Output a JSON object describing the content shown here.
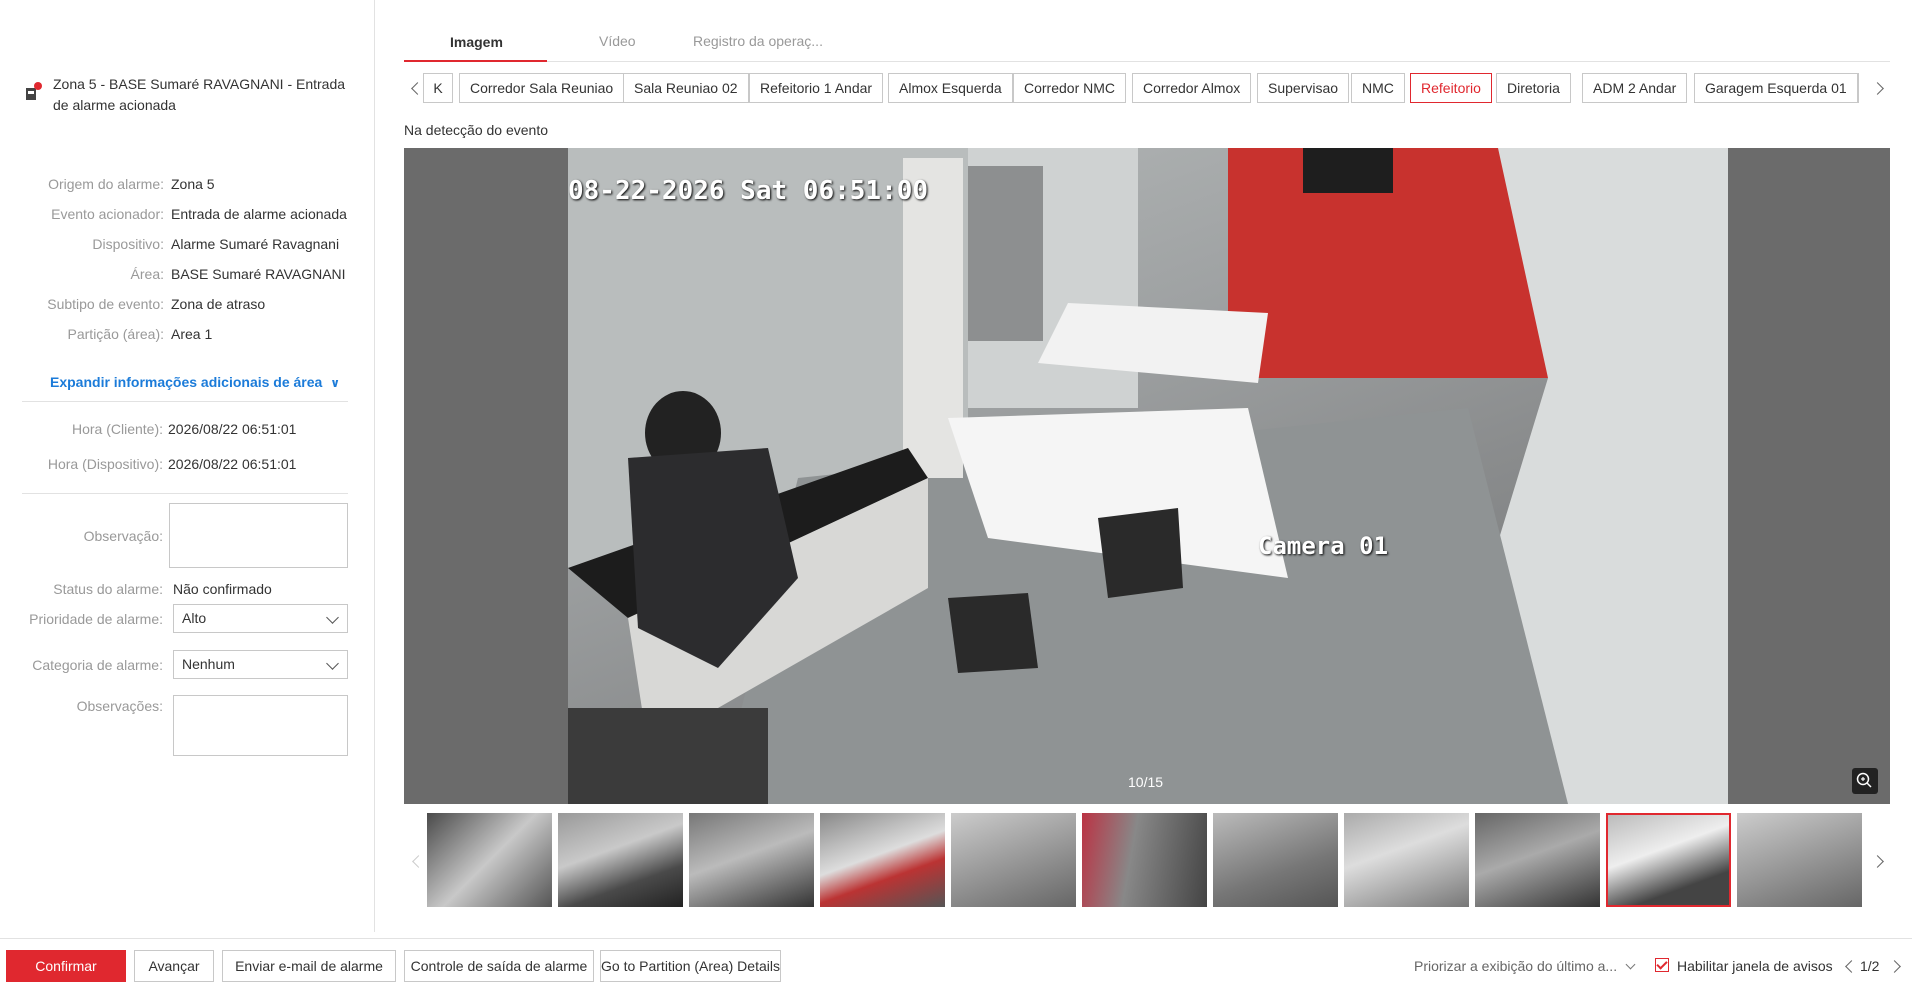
{
  "alarm": {
    "title": "Zona 5 - BASE Sumaré RAVAGNANI - Entrada de alarme acionada"
  },
  "details": [
    {
      "label": "Origem do alarme:",
      "value": "Zona 5"
    },
    {
      "label": "Evento acionador:",
      "value": "Entrada de alarme acionada"
    },
    {
      "label": "Dispositivo:",
      "value": "Alarme Sumaré Ravagnani"
    },
    {
      "label": "Área:",
      "value": "BASE Sumaré RAVAGNANI"
    },
    {
      "label": "Subtipo de evento:",
      "value": "Zona de atraso"
    },
    {
      "label": "Partição (área):",
      "value": "Area 1"
    }
  ],
  "expand_link": "Expandir informações adicionais de área",
  "times": [
    {
      "label": "Hora (Cliente):",
      "value": "2026/08/22 06:51:01"
    },
    {
      "label": "Hora (Dispositivo):",
      "value": "2026/08/22 06:51:01"
    }
  ],
  "form": {
    "observacao_label": "Observação:",
    "status_label": "Status do alarme:",
    "status_value": "Não confirmado",
    "priority_label": "Prioridade de alarme:",
    "priority_value": "Alto",
    "category_label": "Categoria de alarme:",
    "category_value": "Nenhum",
    "observacoes_label": "Observações:"
  },
  "tabs": [
    "Imagem",
    "Vídeo",
    "Registro da operaç..."
  ],
  "camera_tabs": [
    "K",
    "Corredor Sala Reuniao",
    "Sala Reuniao 02",
    "Refeitorio 1 Andar",
    "Almox Esquerda",
    "Corredor NMC",
    "Corredor Almox",
    "Supervisao",
    "NMC",
    "Refeitorio",
    "Diretoria",
    "ADM 2 Andar",
    "Garagem Esquerda 01"
  ],
  "active_camera_tab": "Refeitorio",
  "detection_label": "Na detecção do evento",
  "image": {
    "timestamp": "08-22-2026 Sat 06:51:00",
    "camera_name": "Camera 01",
    "counter": "10/15"
  },
  "thumbnails_count": 11,
  "active_thumbnail": 10,
  "buttons": {
    "confirm": "Confirmar",
    "advance": "Avançar",
    "email": "Enviar e-mail de alarme",
    "output": "Controle de saída de alarme",
    "partition": "Go to Partition (Area) Details"
  },
  "footer": {
    "priority_display": "Priorizar a exibição do último a...",
    "enable_popup": "Habilitar janela de avisos",
    "pager": "1/2"
  },
  "colors": {
    "accent": "#e0282f",
    "link": "#1b7bd9"
  }
}
